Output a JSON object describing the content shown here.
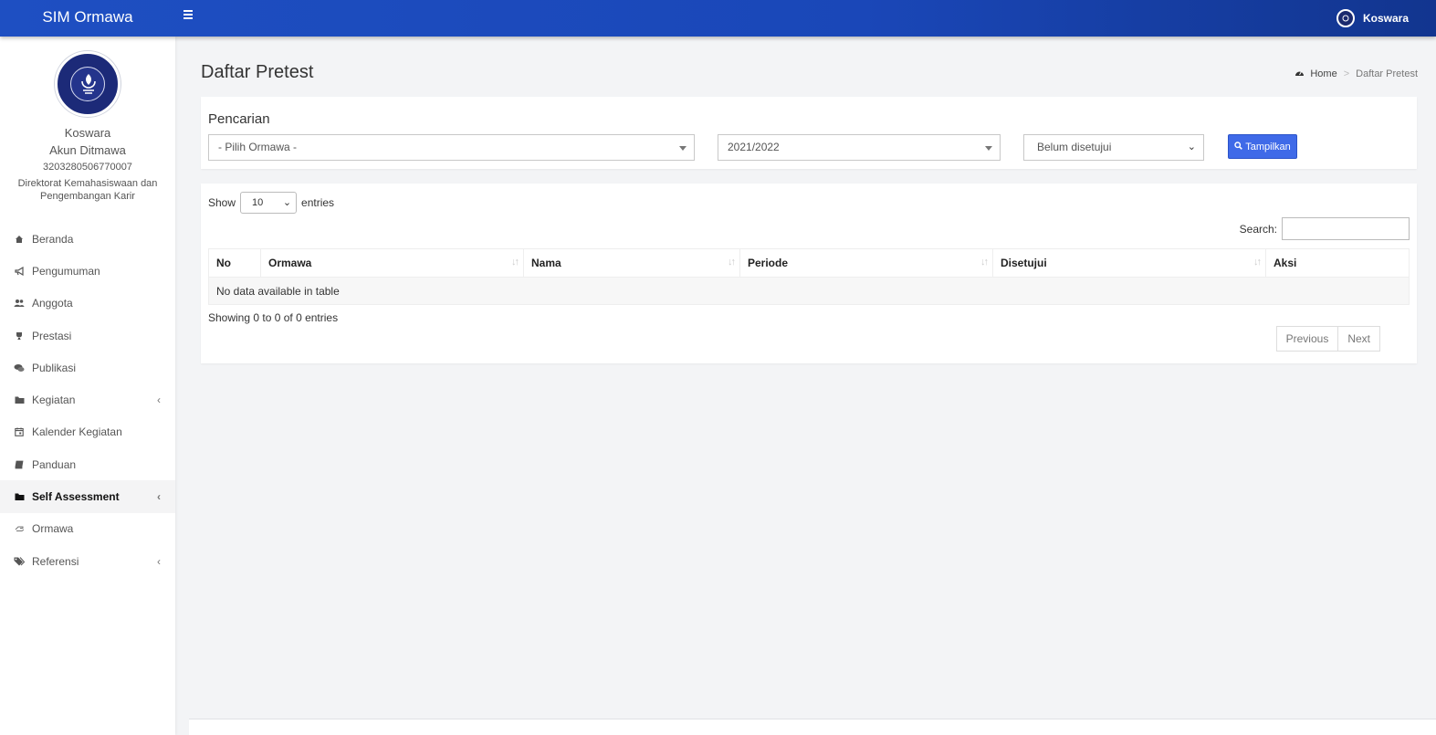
{
  "app": {
    "title": "SIM Ormawa"
  },
  "header": {
    "user_name": "Koswara"
  },
  "profile": {
    "name": "Koswara",
    "role": "Akun Ditmawa",
    "id": "3203280506770007",
    "unit": "Direktorat Kemahasiswaan dan Pengembangan Karir"
  },
  "sidebar": {
    "items": [
      {
        "label": "Beranda",
        "icon": "home-icon"
      },
      {
        "label": "Pengumuman",
        "icon": "megaphone-icon"
      },
      {
        "label": "Anggota",
        "icon": "users-icon"
      },
      {
        "label": "Prestasi",
        "icon": "trophy-icon"
      },
      {
        "label": "Publikasi",
        "icon": "comments-icon"
      },
      {
        "label": "Kegiatan",
        "icon": "folder-icon"
      },
      {
        "label": "Kalender Kegiatan",
        "icon": "calendar-icon"
      },
      {
        "label": "Panduan",
        "icon": "book-icon"
      },
      {
        "label": "Self Assessment",
        "icon": "folder-icon"
      },
      {
        "label": "Ormawa",
        "icon": "hand-icon"
      },
      {
        "label": "Referensi",
        "icon": "tags-icon"
      }
    ]
  },
  "page": {
    "title": "Daftar Pretest",
    "breadcrumb": {
      "home": "Home",
      "current": "Daftar Pretest"
    }
  },
  "search": {
    "title": "Pencarian",
    "ormawa_value": "- Pilih Ormawa -",
    "period_value": "2021/2022",
    "status_value": "Belum disetujui",
    "submit_label": "Tampilkan"
  },
  "table": {
    "show_label": "Show",
    "entries_label": "entries",
    "page_length": "10",
    "search_label": "Search:",
    "columns": [
      "No",
      "Ormawa",
      "Nama",
      "Periode",
      "Disetujui",
      "Aksi"
    ],
    "empty_text": "No data available in table",
    "info": "Showing 0 to 0 of 0 entries",
    "prev_label": "Previous",
    "next_label": "Next"
  },
  "colors": {
    "topbar": "#1e4fc2",
    "primary_button": "#3f6ae8",
    "background": "#f3f4f6"
  }
}
